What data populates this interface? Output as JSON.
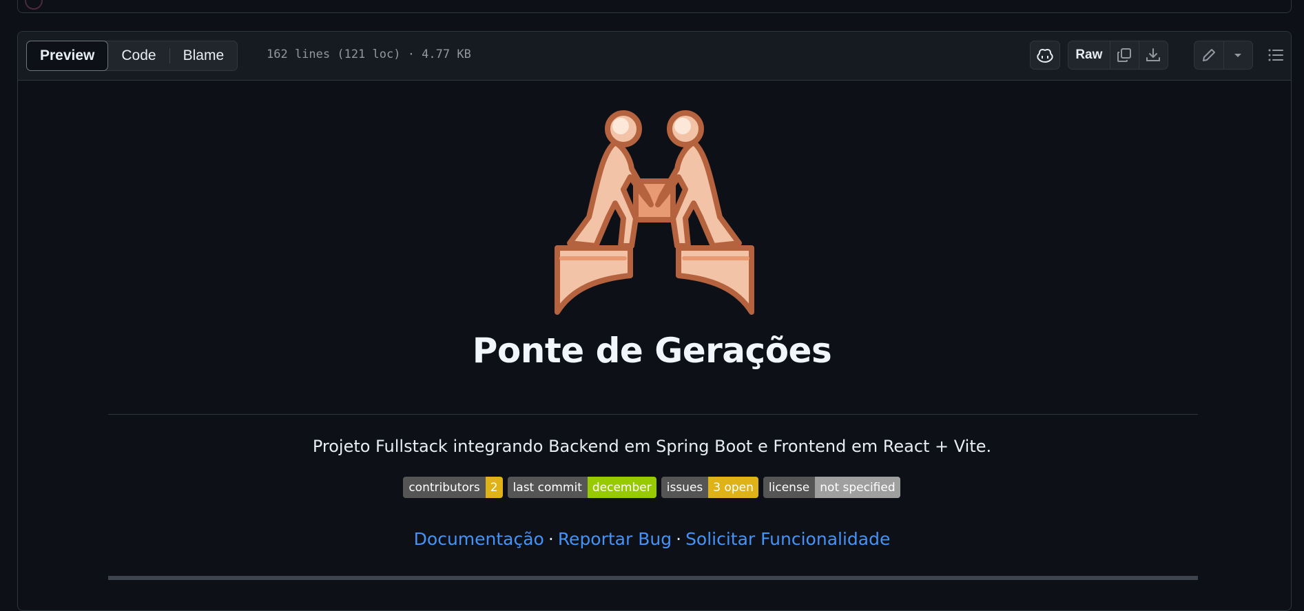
{
  "view_tabs": [
    {
      "label": "Preview"
    },
    {
      "label": "Code"
    },
    {
      "label": "Blame"
    }
  ],
  "file_meta": "162 lines (121 loc) · 4.77 KB",
  "toolbar": {
    "copilot_icon": "copilot-icon",
    "raw_label": "Raw",
    "copy_icon": "copy-icon",
    "download_icon": "download-icon",
    "edit_icon": "pencil-icon",
    "dropdown_icon": "triangle-down-icon",
    "outline_icon": "list-unordered-icon"
  },
  "readme": {
    "logo_icon": "people-building-bridge-icon",
    "title": "Ponte de Gerações",
    "description": "Projeto Fullstack integrando Backend em Spring Boot e Frontend em React + Vite.",
    "badges": [
      {
        "label": "contributors",
        "value": "2",
        "color": "#dfb317"
      },
      {
        "label": "last commit",
        "value": "december",
        "color": "#97ca00"
      },
      {
        "label": "issues",
        "value": "3 open",
        "color": "#dfb317"
      },
      {
        "label": "license",
        "value": "not specified",
        "color": "#9f9f9f"
      }
    ],
    "links": [
      {
        "label": "Documentação"
      },
      {
        "label": "Reportar Bug"
      },
      {
        "label": "Solicitar Funcionalidade"
      }
    ],
    "link_separator": "·"
  },
  "colors": {
    "background": "#0d1117",
    "header_bg": "#161b22",
    "border": "#30363d",
    "link": "#4493f8"
  }
}
